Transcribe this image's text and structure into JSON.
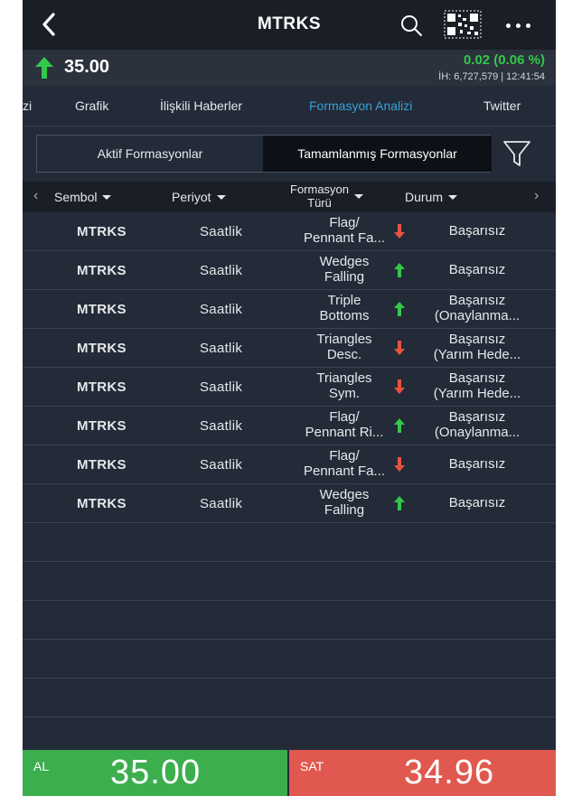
{
  "header": {
    "title": "MTRKS"
  },
  "price_bar": {
    "price": "35.00",
    "change": "0.02 (0.06 %)",
    "volume_time": "İH: 6,727,579 | 12:41:54"
  },
  "tabs": [
    {
      "label": "zi"
    },
    {
      "label": "Grafik"
    },
    {
      "label": "İlişkili Haberler"
    },
    {
      "label": "Formasyon Analizi"
    },
    {
      "label": "Twitter"
    }
  ],
  "segment": {
    "left": "Aktif Formasyonlar",
    "right": "Tamamlanmış Formasyonlar"
  },
  "columns": {
    "symbol": "Sembol",
    "period": "Periyot",
    "type_line1": "Formasyon",
    "type_line2": "Türü",
    "status": "Durum"
  },
  "rows": [
    {
      "symbol": "MTRKS",
      "period": "Saatlik",
      "type1": "Flag/",
      "type2": "Pennant Fa...",
      "direction": "down",
      "status1": "Başarısız",
      "status2": ""
    },
    {
      "symbol": "MTRKS",
      "period": "Saatlik",
      "type1": "Wedges",
      "type2": "Falling",
      "direction": "up",
      "status1": "Başarısız",
      "status2": ""
    },
    {
      "symbol": "MTRKS",
      "period": "Saatlik",
      "type1": "Triple",
      "type2": "Bottoms",
      "direction": "up",
      "status1": "Başarısız",
      "status2": "(Onaylanma..."
    },
    {
      "symbol": "MTRKS",
      "period": "Saatlik",
      "type1": "Triangles",
      "type2": "Desc.",
      "direction": "down",
      "status1": "Başarısız",
      "status2": "(Yarım Hede..."
    },
    {
      "symbol": "MTRKS",
      "period": "Saatlik",
      "type1": "Triangles",
      "type2": "Sym.",
      "direction": "down",
      "status1": "Başarısız",
      "status2": "(Yarım Hede..."
    },
    {
      "symbol": "MTRKS",
      "period": "Saatlik",
      "type1": "Flag/",
      "type2": "Pennant Ri...",
      "direction": "up",
      "status1": "Başarısız",
      "status2": "(Onaylanma..."
    },
    {
      "symbol": "MTRKS",
      "period": "Saatlik",
      "type1": "Flag/",
      "type2": "Pennant Fa...",
      "direction": "down",
      "status1": "Başarısız",
      "status2": ""
    },
    {
      "symbol": "MTRKS",
      "period": "Saatlik",
      "type1": "Wedges",
      "type2": "Falling",
      "direction": "up",
      "status1": "Başarısız",
      "status2": ""
    }
  ],
  "buy": {
    "label": "AL",
    "price": "35.00"
  },
  "sell": {
    "label": "SAT",
    "price": "34.96"
  },
  "colors": {
    "up": "#33c84a",
    "down": "#e8533f",
    "accent": "#3aa0d8",
    "buy_bg": "#3cae4e",
    "sell_bg": "#e0584f"
  }
}
